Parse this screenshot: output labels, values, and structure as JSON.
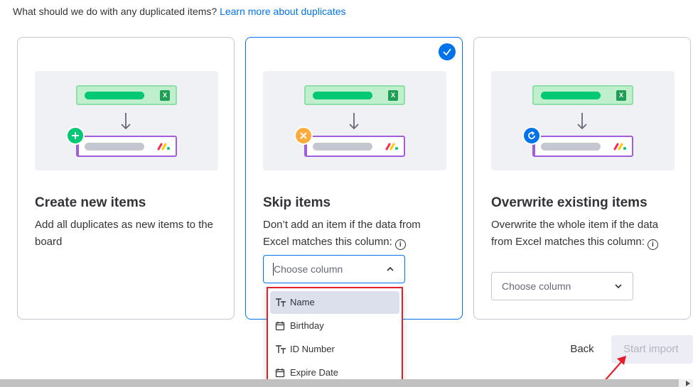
{
  "question": {
    "text": "What should we do with any duplicated items?",
    "link": "Learn more about duplicates"
  },
  "cards": [
    {
      "title": "Create new items",
      "desc": "Add all duplicates as new items to the board",
      "badge": "plus-icon",
      "selected": false
    },
    {
      "title": "Skip items",
      "desc": "Don’t add an item if the data from Excel matches this column:",
      "badge": "x-icon",
      "selected": true,
      "select_placeholder": "Choose column"
    },
    {
      "title": "Overwrite existing items",
      "desc": "Overwrite the whole item if the data from Excel matches this column:",
      "badge": "refresh-icon",
      "selected": false,
      "select_placeholder": "Choose column"
    }
  ],
  "dropdown": {
    "options": [
      {
        "label": "Name",
        "icon": "text-type-icon",
        "highlighted": true
      },
      {
        "label": "Birthday",
        "icon": "calendar-icon",
        "highlighted": false
      },
      {
        "label": "ID Number",
        "icon": "text-type-icon",
        "highlighted": false
      },
      {
        "label": "Expire Date",
        "icon": "calendar-icon",
        "highlighted": false
      }
    ]
  },
  "footer": {
    "back_label": "Back",
    "start_label": "Start import"
  },
  "colors": {
    "accent": "#0073ea",
    "highlight_border": "#e2202a",
    "green": "#00c875",
    "orange": "#fdab3d",
    "purple": "#a25ddc"
  }
}
